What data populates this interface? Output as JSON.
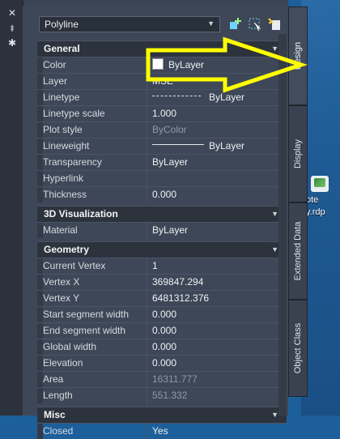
{
  "title_buttons": {
    "close": "✕",
    "pin": "⯒",
    "settings": "✱"
  },
  "object_selector": {
    "value": "Polyline"
  },
  "tabs": {
    "design": "Design",
    "display": "Display",
    "extended_data": "Extended Data",
    "object_class": "Object Class"
  },
  "desktop_icon_label": {
    "line1": "ote",
    "line2": "y.rdp"
  },
  "categories": {
    "general": {
      "title": "General",
      "rows": [
        {
          "label": "Color",
          "value": "ByLayer"
        },
        {
          "label": "Layer",
          "value": "MSE"
        },
        {
          "label": "Linetype",
          "value": "ByLayer"
        },
        {
          "label": "Linetype scale",
          "value": "1.000"
        },
        {
          "label": "Plot style",
          "value": "ByColor"
        },
        {
          "label": "Lineweight",
          "value": "ByLayer"
        },
        {
          "label": "Transparency",
          "value": "ByLayer"
        },
        {
          "label": "Hyperlink",
          "value": ""
        },
        {
          "label": "Thickness",
          "value": "0.000"
        }
      ]
    },
    "viz3d": {
      "title": "3D Visualization",
      "rows": [
        {
          "label": "Material",
          "value": "ByLayer"
        }
      ]
    },
    "geometry": {
      "title": "Geometry",
      "rows": [
        {
          "label": "Current Vertex",
          "value": "1"
        },
        {
          "label": "Vertex X",
          "value": "369847.294"
        },
        {
          "label": "Vertex Y",
          "value": "6481312.376"
        },
        {
          "label": "Start segment width",
          "value": "0.000"
        },
        {
          "label": "End segment width",
          "value": "0.000"
        },
        {
          "label": "Global width",
          "value": "0.000"
        },
        {
          "label": "Elevation",
          "value": "0.000"
        },
        {
          "label": "Area",
          "value": "16311.777"
        },
        {
          "label": "Length",
          "value": "551.332"
        }
      ]
    },
    "misc": {
      "title": "Misc",
      "rows": [
        {
          "label": "Closed",
          "value": "Yes"
        }
      ]
    }
  },
  "colors": {
    "annotation_arrow": "#ffff00",
    "panel_bg": "#3e4757"
  }
}
